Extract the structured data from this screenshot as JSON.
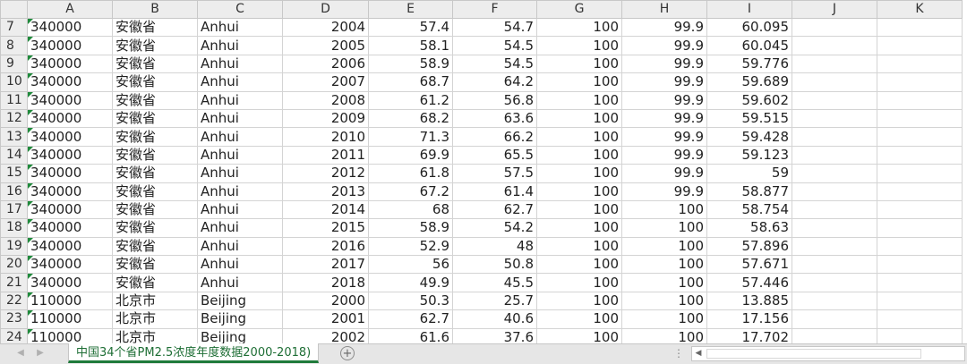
{
  "columns": [
    "A",
    "B",
    "C",
    "D",
    "E",
    "F",
    "G",
    "H",
    "I",
    "J",
    "K"
  ],
  "rows": [
    {
      "row": "7",
      "a": "340000",
      "b": "安徽省",
      "c": "Anhui",
      "d": "2004",
      "e": "57.4",
      "f": "54.7",
      "g": "100",
      "h": "99.9",
      "i": "60.095"
    },
    {
      "row": "8",
      "a": "340000",
      "b": "安徽省",
      "c": "Anhui",
      "d": "2005",
      "e": "58.1",
      "f": "54.5",
      "g": "100",
      "h": "99.9",
      "i": "60.045"
    },
    {
      "row": "9",
      "a": "340000",
      "b": "安徽省",
      "c": "Anhui",
      "d": "2006",
      "e": "58.9",
      "f": "54.5",
      "g": "100",
      "h": "99.9",
      "i": "59.776"
    },
    {
      "row": "10",
      "a": "340000",
      "b": "安徽省",
      "c": "Anhui",
      "d": "2007",
      "e": "68.7",
      "f": "64.2",
      "g": "100",
      "h": "99.9",
      "i": "59.689"
    },
    {
      "row": "11",
      "a": "340000",
      "b": "安徽省",
      "c": "Anhui",
      "d": "2008",
      "e": "61.2",
      "f": "56.8",
      "g": "100",
      "h": "99.9",
      "i": "59.602"
    },
    {
      "row": "12",
      "a": "340000",
      "b": "安徽省",
      "c": "Anhui",
      "d": "2009",
      "e": "68.2",
      "f": "63.6",
      "g": "100",
      "h": "99.9",
      "i": "59.515"
    },
    {
      "row": "13",
      "a": "340000",
      "b": "安徽省",
      "c": "Anhui",
      "d": "2010",
      "e": "71.3",
      "f": "66.2",
      "g": "100",
      "h": "99.9",
      "i": "59.428"
    },
    {
      "row": "14",
      "a": "340000",
      "b": "安徽省",
      "c": "Anhui",
      "d": "2011",
      "e": "69.9",
      "f": "65.5",
      "g": "100",
      "h": "99.9",
      "i": "59.123"
    },
    {
      "row": "15",
      "a": "340000",
      "b": "安徽省",
      "c": "Anhui",
      "d": "2012",
      "e": "61.8",
      "f": "57.5",
      "g": "100",
      "h": "99.9",
      "i": "59"
    },
    {
      "row": "16",
      "a": "340000",
      "b": "安徽省",
      "c": "Anhui",
      "d": "2013",
      "e": "67.2",
      "f": "61.4",
      "g": "100",
      "h": "99.9",
      "i": "58.877"
    },
    {
      "row": "17",
      "a": "340000",
      "b": "安徽省",
      "c": "Anhui",
      "d": "2014",
      "e": "68",
      "f": "62.7",
      "g": "100",
      "h": "100",
      "i": "58.754"
    },
    {
      "row": "18",
      "a": "340000",
      "b": "安徽省",
      "c": "Anhui",
      "d": "2015",
      "e": "58.9",
      "f": "54.2",
      "g": "100",
      "h": "100",
      "i": "58.63"
    },
    {
      "row": "19",
      "a": "340000",
      "b": "安徽省",
      "c": "Anhui",
      "d": "2016",
      "e": "52.9",
      "f": "48",
      "g": "100",
      "h": "100",
      "i": "57.896"
    },
    {
      "row": "20",
      "a": "340000",
      "b": "安徽省",
      "c": "Anhui",
      "d": "2017",
      "e": "56",
      "f": "50.8",
      "g": "100",
      "h": "100",
      "i": "57.671"
    },
    {
      "row": "21",
      "a": "340000",
      "b": "安徽省",
      "c": "Anhui",
      "d": "2018",
      "e": "49.9",
      "f": "45.5",
      "g": "100",
      "h": "100",
      "i": "57.446"
    },
    {
      "row": "22",
      "a": "110000",
      "b": "北京市",
      "c": "Beijing",
      "d": "2000",
      "e": "50.3",
      "f": "25.7",
      "g": "100",
      "h": "100",
      "i": "13.885"
    },
    {
      "row": "23",
      "a": "110000",
      "b": "北京市",
      "c": "Beijing",
      "d": "2001",
      "e": "62.7",
      "f": "40.6",
      "g": "100",
      "h": "100",
      "i": "17.156"
    },
    {
      "row": "24",
      "a": "110000",
      "b": "北京市",
      "c": "Beijing",
      "d": "2002",
      "e": "61.6",
      "f": "37.6",
      "g": "100",
      "h": "100",
      "i": "17.702"
    }
  ],
  "sheet_tab": {
    "label": "中国34个省PM2.5浓度年度数据2000-2018)"
  },
  "add_sheet": {
    "label": "+"
  },
  "colors": {
    "accent": "#1f7a3a",
    "header_bg": "#ededed",
    "gridline": "#d4d4d4"
  }
}
